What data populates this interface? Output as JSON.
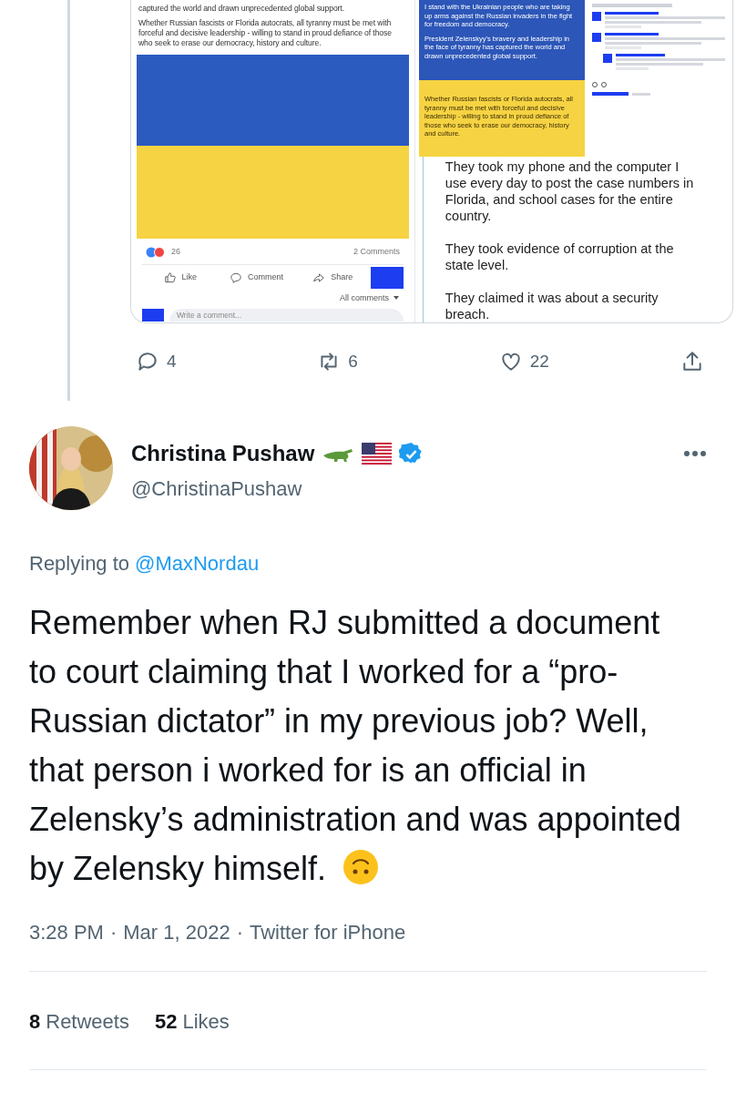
{
  "quoted_media": {
    "facebook_post": {
      "paragraphs": [
        "captured the world and drawn unprecedented global support.",
        "Whether Russian fascists or Florida autocrats, all tyranny must be met with forceful and decisive leadership - willing to stand in proud defiance of those who seek to erase our democracy, history and culture."
      ],
      "reactions_count": "26",
      "comments_count": "2 Comments",
      "actions": [
        {
          "kind": "like",
          "label": "Like"
        },
        {
          "kind": "comment",
          "label": "Comment"
        },
        {
          "kind": "share",
          "label": "Share"
        }
      ],
      "all_comments": "All comments",
      "comment_placeholder": "Write a comment..."
    },
    "graphic": {
      "blue_paragraphs": [
        "I stand with the Ukrainian people who are taking up arms against the Russian invaders in the fight for freedom and democracy.",
        "President Zelenskyy's bravery and leadership in the face of tyranny has captured the world and drawn unprecedented global support."
      ],
      "yellow_text": "Whether Russian fascists or Florida autocrats, all tyranny must be met with forceful and decisive leadership - willing to stand in proud defiance of those who seek to erase our democracy, history and culture."
    },
    "note_paragraphs": [
      "They took my phone and the computer I use every day to post the case numbers in Florida, and school cases for the entire country.",
      "They took evidence of corruption at the state level.",
      "They claimed it was about a security breach."
    ]
  },
  "actions": [
    {
      "kind": "reply",
      "count": "4"
    },
    {
      "kind": "retweet",
      "count": "6"
    },
    {
      "kind": "like",
      "count": "22"
    },
    {
      "kind": "share"
    }
  ],
  "tweet": {
    "name": "Christina Pushaw",
    "verified": true,
    "handle": "@ChristinaPushaw",
    "replying_prefix": "Replying to",
    "replying_to": "@MaxNordau",
    "text": "Remember when RJ submitted a document to court claiming that I worked for a “pro-Russian dictator” in my previous job? Well, that person i worked for is an official in Zelensky’s administration and was appointed by Zelensky himself.",
    "meta": [
      "3:28 PM",
      "Mar 1, 2022",
      "Twitter for iPhone"
    ],
    "meta_separator": "·",
    "stats": [
      {
        "count": "8",
        "label": "Retweets"
      },
      {
        "count": "52",
        "label": "Likes"
      }
    ]
  }
}
